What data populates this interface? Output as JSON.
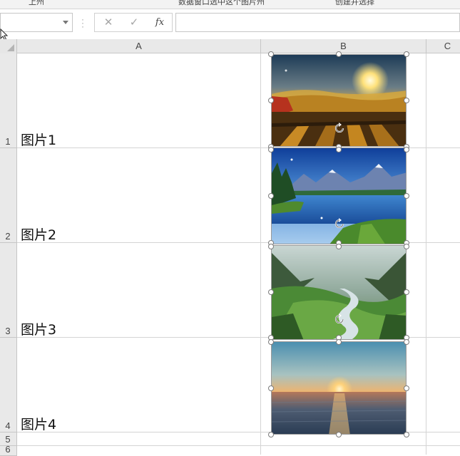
{
  "ribbon_fragments": [
    "上州",
    "数据窗口选中这个图片州",
    "创建并选择"
  ],
  "formula_bar": {
    "name_box_value": "",
    "cancel_icon": "✕",
    "enter_icon": "✓",
    "fx_label": "fx",
    "formula_value": ""
  },
  "columns": [
    "A",
    "B",
    "C"
  ],
  "rows": [
    {
      "number": "1",
      "a_value": "图片1"
    },
    {
      "number": "2",
      "a_value": "图片2"
    },
    {
      "number": "3",
      "a_value": "图片3"
    },
    {
      "number": "4",
      "a_value": "图片4"
    },
    {
      "number": "5",
      "a_value": ""
    },
    {
      "number": "6",
      "a_value": ""
    }
  ],
  "pictures": [
    {
      "subject": "sunrise-over-fields",
      "selected": true
    },
    {
      "subject": "mountain-lake",
      "selected": true
    },
    {
      "subject": "river-valley",
      "selected": true
    },
    {
      "subject": "ocean-sunset",
      "selected": true
    }
  ],
  "colors": {
    "header_bg": "#e9e9e9",
    "gridline": "#d4d4d4",
    "handle": "#7a7a7a"
  }
}
